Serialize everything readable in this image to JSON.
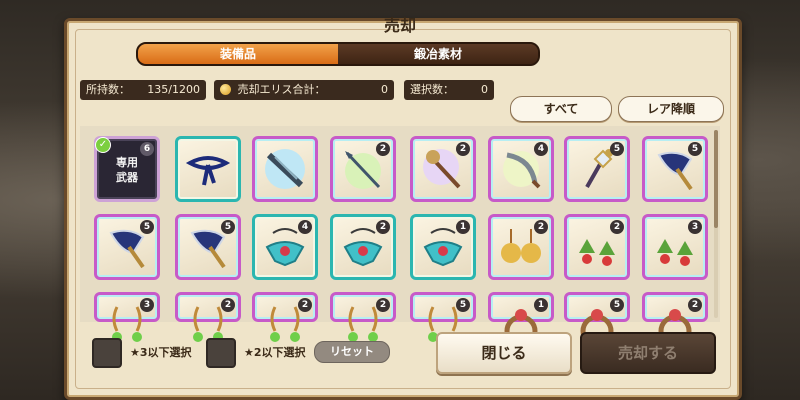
{
  "title": "売却",
  "tabs": [
    {
      "label": "装備品",
      "active": true
    },
    {
      "label": "鍛冶素材",
      "active": false
    }
  ],
  "info": {
    "owned_label": "所持数：",
    "owned_value": "135/1200",
    "sale_total_label": "売却エリス合計：",
    "sale_total_value": "0",
    "selected_label": "選択数：",
    "selected_value": "0"
  },
  "buttons": {
    "all": "すべて",
    "rarity_desc": "レア降順",
    "reset": "リセット",
    "close": "閉じる",
    "sell": "売却する"
  },
  "bottom": {
    "star3_label": "★3以下選択",
    "star2_label": "★2以下選択"
  },
  "items": [
    {
      "icon": "exclusive-weapon-icon",
      "count": "6",
      "label": "専用\n武器",
      "selected": true
    },
    {
      "icon": "ribbon-icon",
      "count": ""
    },
    {
      "icon": "ice-sword-icon",
      "count": ""
    },
    {
      "icon": "wind-spear-icon",
      "count": "2"
    },
    {
      "icon": "staff-icon",
      "count": "2"
    },
    {
      "icon": "scimitar-icon",
      "count": "4"
    },
    {
      "icon": "scepter-icon",
      "count": "5"
    },
    {
      "icon": "axe-icon",
      "count": "5"
    },
    {
      "icon": "axe-icon",
      "count": "5"
    },
    {
      "icon": "axe-icon",
      "count": "5"
    },
    {
      "icon": "necklace-icon",
      "count": "4"
    },
    {
      "icon": "necklace-icon",
      "count": "2"
    },
    {
      "icon": "necklace-icon",
      "count": "1"
    },
    {
      "icon": "shell-earring-icon",
      "count": "2"
    },
    {
      "icon": "leaf-earring-icon",
      "count": "2"
    },
    {
      "icon": "leaf-earring-icon",
      "count": "3"
    },
    {
      "icon": "earring-icon",
      "count": "3"
    },
    {
      "icon": "earring-icon",
      "count": "2"
    },
    {
      "icon": "earring-icon",
      "count": "2"
    },
    {
      "icon": "earring-icon",
      "count": "2"
    },
    {
      "icon": "earring-icon",
      "count": "5"
    },
    {
      "icon": "ring-icon",
      "count": "1"
    },
    {
      "icon": "ring-icon",
      "count": "5"
    },
    {
      "icon": "ring-icon",
      "count": "2"
    }
  ]
}
